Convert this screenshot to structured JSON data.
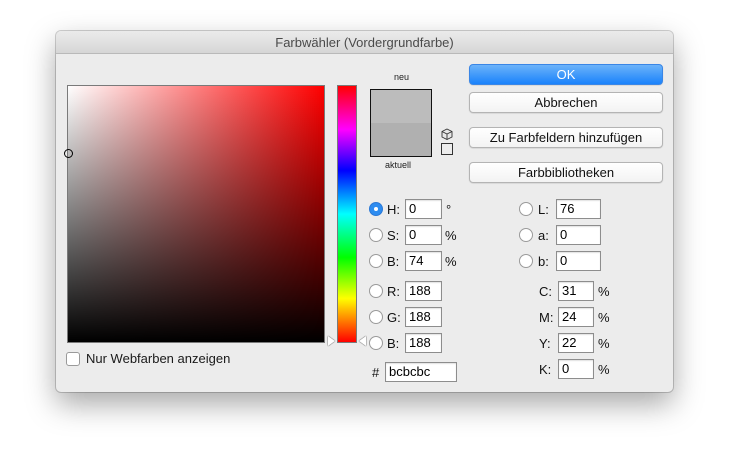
{
  "window": {
    "title": "Farbwähler (Vordergrundfarbe)"
  },
  "preview": {
    "new_label": "neu",
    "current_label": "aktuell",
    "new_color": "#bcbcbc",
    "current_color": "#b0b0b0"
  },
  "options": {
    "webcolors_label": "Nur Webfarben anzeigen"
  },
  "buttons": {
    "ok": "OK",
    "cancel": "Abbrechen",
    "add_swatches": "Zu Farbfeldern hinzufügen",
    "libraries": "Farbbibliotheken"
  },
  "hsb": {
    "h": {
      "label": "H:",
      "value": "0",
      "unit": "°"
    },
    "s": {
      "label": "S:",
      "value": "0",
      "unit": "%"
    },
    "b": {
      "label": "B:",
      "value": "74",
      "unit": "%"
    }
  },
  "rgb": {
    "r": {
      "label": "R:",
      "value": "188"
    },
    "g": {
      "label": "G:",
      "value": "188"
    },
    "b": {
      "label": "B:",
      "value": "188"
    }
  },
  "lab": {
    "l": {
      "label": "L:",
      "value": "76"
    },
    "a": {
      "label": "a:",
      "value": "0"
    },
    "b": {
      "label": "b:",
      "value": "0"
    }
  },
  "cmyk": {
    "c": {
      "label": "C:",
      "value": "31",
      "unit": "%"
    },
    "m": {
      "label": "M:",
      "value": "24",
      "unit": "%"
    },
    "y": {
      "label": "Y:",
      "value": "22",
      "unit": "%"
    },
    "k": {
      "label": "K:",
      "value": "0",
      "unit": "%"
    }
  },
  "hex": {
    "label": "#",
    "value": "bcbcbc"
  }
}
